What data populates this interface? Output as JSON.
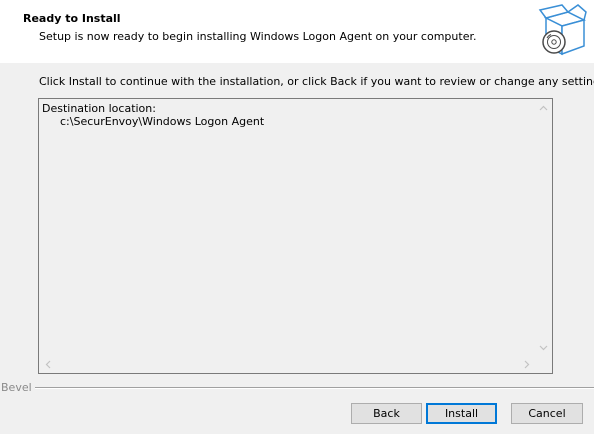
{
  "header": {
    "title": "Ready to Install",
    "subtitle": "Setup is now ready to begin installing Windows Logon Agent on your computer.",
    "icon": "install-box-icon"
  },
  "instruction": "Click Install to continue with the installation, or click Back if you want to review or change any settings.",
  "summary": {
    "lines": [
      "Destination location:",
      "c:\\SecurEnvoy\\Windows Logon Agent"
    ]
  },
  "bevel": {
    "label": "Bevel"
  },
  "buttons": {
    "back": "Back",
    "install": "Install",
    "cancel": "Cancel"
  },
  "colors": {
    "default_button_border": "#0078d7",
    "icon_accent": "#3a8fd6"
  }
}
